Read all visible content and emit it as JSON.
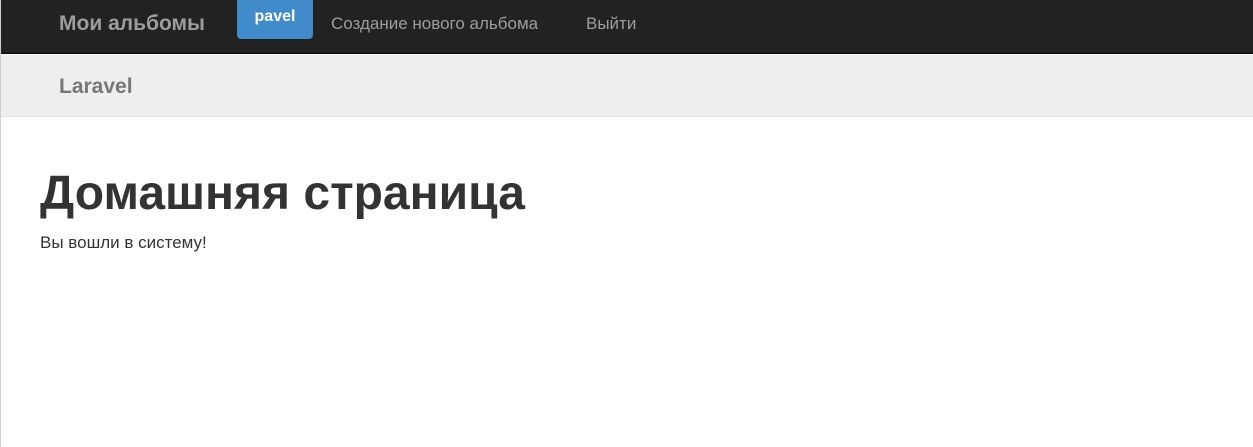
{
  "navbar": {
    "brand": "Мои альбомы",
    "user": "pavel",
    "create_album": "Создание нового альбома",
    "logout": "Выйти"
  },
  "subnav": {
    "brand": "Laravel"
  },
  "main": {
    "title": "Домашняя страница",
    "message": "Вы вошли в систему!"
  },
  "colors": {
    "navbar_bg": "#222222",
    "user_badge": "#428bca",
    "subnav_bg": "#eeeeee"
  }
}
